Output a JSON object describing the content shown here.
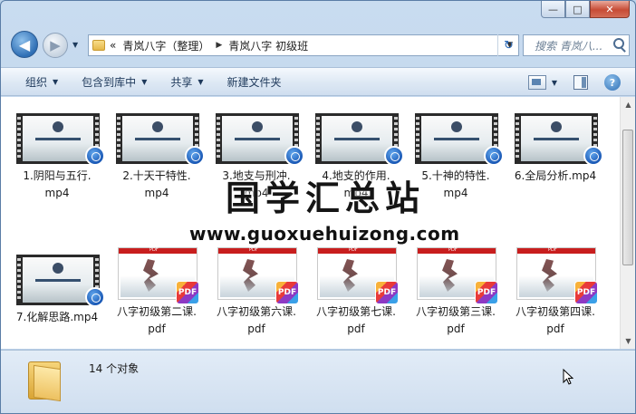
{
  "window": {
    "caption": {
      "minimize": "—",
      "maximize": "□",
      "close": "✕"
    }
  },
  "nav": {
    "back_icon": "◀",
    "forward_icon": "▶",
    "breadcrumb": [
      "«",
      "青岚八字（整理）",
      "青岚八字 初级班"
    ],
    "breadcrumb_sep": "▶",
    "refresh_icon": "↻",
    "search_placeholder": "搜索 青岚八..."
  },
  "toolbar": {
    "organize": "组织",
    "include_library": "包含到库中",
    "share": "共享",
    "new_folder": "新建文件夹",
    "help": "?"
  },
  "files": [
    {
      "name": "1.阴阳与五行.mp4",
      "type": "video"
    },
    {
      "name": "2.十天干特性.mp4",
      "type": "video"
    },
    {
      "name": "3.地支与刑冲.mp4",
      "type": "video"
    },
    {
      "name": "4.地支的作用.mp4",
      "type": "video"
    },
    {
      "name": "5.十神的特性.mp4",
      "type": "video"
    },
    {
      "name": "6.全局分析.mp4",
      "type": "video"
    },
    {
      "name": "7.化解思路.mp4",
      "type": "video"
    },
    {
      "name": "八字初级第二课.pdf",
      "type": "pdf"
    },
    {
      "name": "八字初级第六课.pdf",
      "type": "pdf"
    },
    {
      "name": "八字初级第七课.pdf",
      "type": "pdf"
    },
    {
      "name": "八字初级第三课.pdf",
      "type": "pdf"
    },
    {
      "name": "八字初级第四课.pdf",
      "type": "pdf"
    }
  ],
  "labels": {
    "f1a": "1.阴阳与五行.",
    "f1b": "mp4",
    "f2a": "2.十天干特性.",
    "f2b": "mp4",
    "f3a": "3.地支与刑冲.",
    "f3b": "mp4",
    "f4a": "4.地支的作用.",
    "f4b": "mp4",
    "f5a": "5.十神的特性.",
    "f5b": "mp4",
    "f6a": "6.全局分析.mp4",
    "f7a": "7.化解思路.mp4",
    "f8a": "八字初级第二课.",
    "f8b": "pdf",
    "f9a": "八字初级第六课.",
    "f9b": "pdf",
    "f10a": "八字初级第七课.",
    "f10b": "pdf",
    "f11a": "八字初级第三课.",
    "f11b": "pdf",
    "f12a": "八字初级第四课.",
    "f12b": "pdf"
  },
  "pdf_badge": "PDF",
  "pdf_header": "PDF",
  "watermark": {
    "title": "国学汇总站",
    "url": "www.guoxuehuizong.com"
  },
  "status": {
    "count": "14 个对象"
  },
  "colors": {
    "accent": "#2f6fb5",
    "close": "#c74c36",
    "pdf_red": "#c81e1e"
  }
}
